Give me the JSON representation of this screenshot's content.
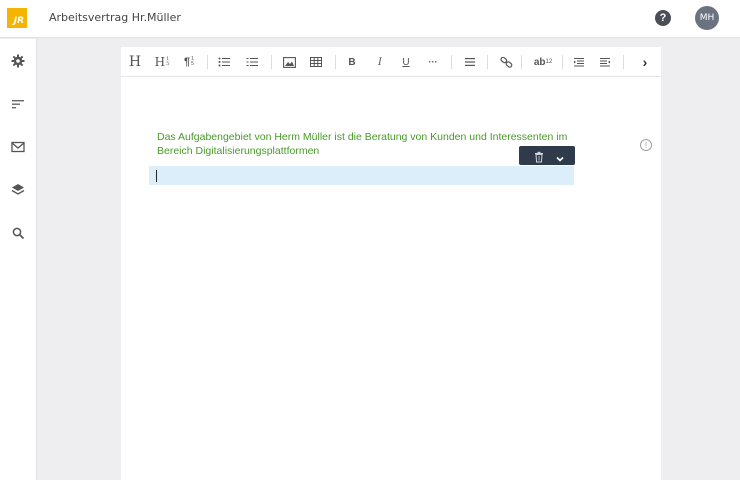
{
  "app": {
    "logo_text": "JR",
    "document_title": "Arbeitsvertrag Hr.Müller",
    "help_label": "?",
    "user_initials": "MH"
  },
  "sidebar": {
    "items": [
      {
        "icon": "gear-icon"
      },
      {
        "icon": "outline-icon"
      },
      {
        "icon": "mail-icon"
      },
      {
        "icon": "layers-icon"
      },
      {
        "icon": "search-icon"
      }
    ]
  },
  "toolbar": {
    "heading": "H",
    "subheading": "H",
    "subheading_sup": "1",
    "subheading_sub": "5",
    "paragraph": "¶",
    "paragraph_sup": "1",
    "paragraph_sub": "5",
    "bold": "B",
    "italic": "I",
    "underline": "U",
    "more": "···",
    "superscript_base": "ab",
    "superscript_sup": "12",
    "next": "›"
  },
  "document": {
    "paragraph_text": "Das Aufgabengebiet von Herm Müller ist die Beratung von Kunden und Interessenten im Bereich Digitalisierungsplattformen",
    "paragraph_color": "#4a9a2a",
    "info_label": "!"
  },
  "colors": {
    "logo": "#f5b400",
    "block_toolbar": "#2f3b4a",
    "active_line": "#ddeefb"
  }
}
